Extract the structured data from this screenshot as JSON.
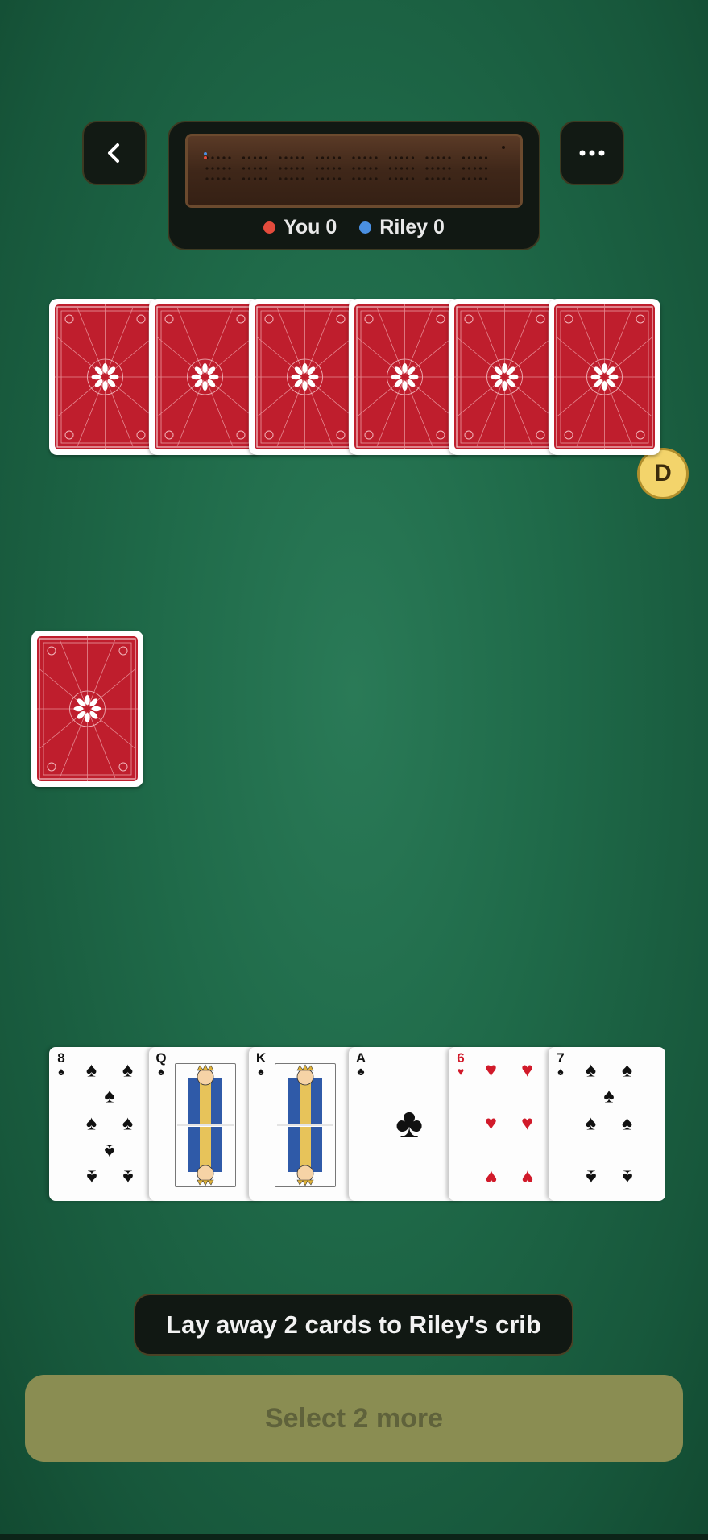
{
  "header": {
    "back_icon": "chevron-left-icon",
    "menu_icon": "more-horizontal-icon",
    "scores": [
      {
        "name": "You",
        "score": "0",
        "label": "You 0",
        "color": "#e44b3c"
      },
      {
        "name": "Riley",
        "score": "0",
        "label": "Riley 0",
        "color": "#4a90e2"
      }
    ]
  },
  "opponent": {
    "hand_count": 6,
    "card_back_color": "#bf1e2d"
  },
  "dealer_badge": "D",
  "player_hand": [
    {
      "rank": "8",
      "suit": "♠",
      "color": "black"
    },
    {
      "rank": "Q",
      "suit": "♠",
      "color": "black"
    },
    {
      "rank": "K",
      "suit": "♠",
      "color": "black"
    },
    {
      "rank": "A",
      "suit": "♣",
      "color": "black"
    },
    {
      "rank": "6",
      "suit": "♥",
      "color": "red"
    },
    {
      "rank": "7",
      "suit": "♠",
      "color": "black"
    }
  ],
  "status_message": "Lay away 2 cards to Riley's crib",
  "action_button": "Select 2 more"
}
